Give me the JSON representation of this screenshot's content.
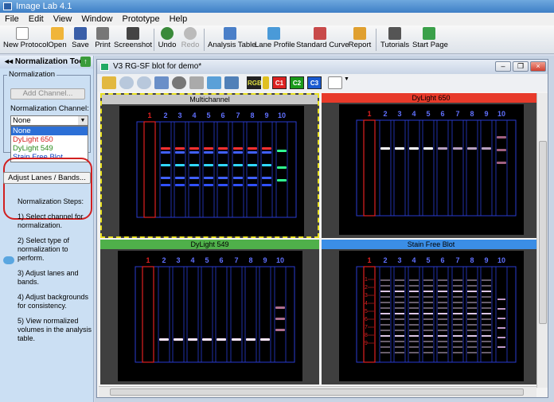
{
  "app": {
    "title": "Image Lab 4.1"
  },
  "menu": [
    "File",
    "Edit",
    "View",
    "Window",
    "Prototype",
    "Help"
  ],
  "toolbar": {
    "new_protocol": "New Protocol",
    "open": "Open",
    "save": "Save",
    "print": "Print",
    "screenshot": "Screenshot",
    "undo": "Undo",
    "redo": "Redo",
    "analysis_table": "Analysis Table",
    "lane_profile": "Lane Profile",
    "standard_curve": "Standard Curve",
    "report": "Report",
    "tutorials": "Tutorials",
    "start_page": "Start Page"
  },
  "left": {
    "title": "Normalization Tools",
    "group": "Normalization",
    "add_channel": "Add Channel...",
    "channel_label": "Normalization Channel:",
    "selected": "None",
    "options": [
      {
        "label": "None",
        "color": "#ffffff"
      },
      {
        "label": "DyLight 650",
        "color": "#d42020"
      },
      {
        "label": "DyLight 549",
        "color": "#2a8a1c"
      },
      {
        "label": "Stain Free Blot",
        "color": "#1040c0"
      }
    ],
    "adjust_button": "Adjust Lanes / Bands...",
    "steps": [
      "Normalization Steps:",
      "1) Select channel for normalization.",
      "2) Select type of normalization to perform.",
      "3) Adjust lanes and bands.",
      "4) Adjust backgrounds for consistency.",
      "5) View normalized volumes in the analysis table."
    ]
  },
  "window": {
    "title": "V3 RG-SF blot for demo*",
    "channels": {
      "rgb": "RGB",
      "c1": "C1",
      "c2": "C2",
      "c3": "C3"
    }
  },
  "panels": [
    {
      "name": "Multichannel",
      "header_color": "#c8c8c8"
    },
    {
      "name": "DyLight 650",
      "header_color": "#e83a2a"
    },
    {
      "name": "DyLight 549",
      "header_color": "#4fb04a"
    },
    {
      "name": "Stain Free Blot",
      "header_color": "#3b8ee6"
    }
  ],
  "lane_numbers": [
    "1",
    "2",
    "3",
    "4",
    "5",
    "6",
    "7",
    "8",
    "9",
    "10"
  ],
  "band_numbers": [
    "1",
    "2",
    "3",
    "4",
    "5",
    "6",
    "7",
    "8",
    "9"
  ],
  "colors": {
    "accent": "#d12020",
    "lane_outline": "#2a3bd0",
    "lane1": "#e02020",
    "selection": "#e8e020"
  }
}
